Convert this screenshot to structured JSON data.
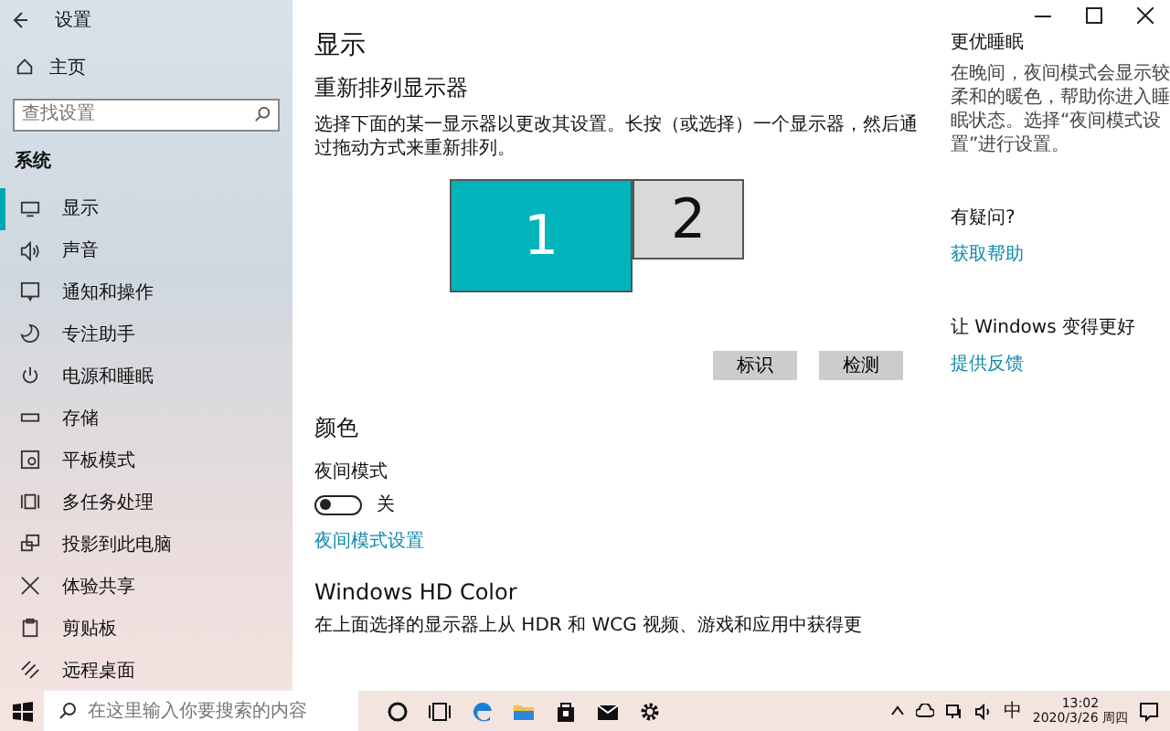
{
  "window": {
    "title": "设置"
  },
  "sidebar": {
    "home": "主页",
    "search": {
      "placeholder": "查找设置"
    },
    "section": "系统",
    "items": [
      {
        "label": "显示",
        "selected": true
      },
      {
        "label": "声音",
        "selected": false
      },
      {
        "label": "通知和操作",
        "selected": false
      },
      {
        "label": "专注助手",
        "selected": false
      },
      {
        "label": "电源和睡眠",
        "selected": false
      },
      {
        "label": "存储",
        "selected": false
      },
      {
        "label": "平板模式",
        "selected": false
      },
      {
        "label": "多任务处理",
        "selected": false
      },
      {
        "label": "投影到此电脑",
        "selected": false
      },
      {
        "label": "体验共享",
        "selected": false
      },
      {
        "label": "剪贴板",
        "selected": false
      },
      {
        "label": "远程桌面",
        "selected": false
      }
    ]
  },
  "main": {
    "title": "显示",
    "arrange": {
      "heading": "重新排列显示器",
      "description": "选择下面的某一显示器以更改其设置。长按（或选择）一个显示器，然后通过拖动方式来重新排列。",
      "monitors": [
        {
          "label": "1",
          "selected": true
        },
        {
          "label": "2",
          "selected": false
        }
      ],
      "buttons": [
        "标识",
        "检测"
      ]
    },
    "color": {
      "heading": "颜色",
      "night_light": {
        "label": "夜间模式",
        "on": false,
        "state": "关"
      },
      "link": "夜间模式设置"
    },
    "hd_color": {
      "heading": "Windows HD Color",
      "description": "在上面选择的显示器上从 HDR 和 WCG 视频、游戏和应用中获得更"
    }
  },
  "aside": [
    {
      "heading": "更优睡眠",
      "text": "在晚间，夜间模式会显示较柔和的暖色，帮助你进入睡眠状态。选择“夜间模式设置”进行设置。"
    },
    {
      "heading": "有疑问?",
      "link": "获取帮助"
    },
    {
      "heading": "让 Windows 变得更好",
      "link": "提供反馈"
    }
  ],
  "taskbar": {
    "search": {
      "placeholder": "在这里输入你要搜索的内容"
    },
    "ime": "中",
    "time": "13:02",
    "date": "2020/3/26 周四"
  }
}
